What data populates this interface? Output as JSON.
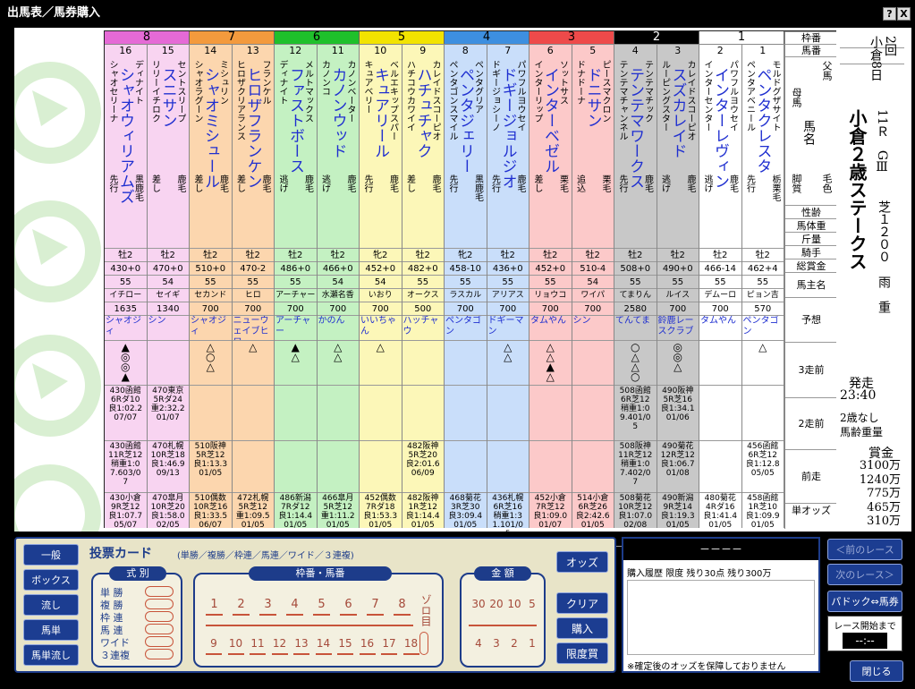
{
  "window": {
    "title": "出馬表／馬券購入",
    "help_label": "?",
    "close_label": "X"
  },
  "race": {
    "kai": "2回",
    "place": "小倉",
    "day": "8日",
    "race_no": "11Ｒ",
    "grade": "GⅢ",
    "name": "小倉２歳ステークス",
    "surface_dist": "芝１２００",
    "weather": "雨",
    "condition": "重",
    "start_label": "発走",
    "start_time": "23:40",
    "cond1": "2歳なし",
    "cond2": "馬齢重量",
    "prize_label": "賞金",
    "prizes": [
      "3100万",
      "1240万",
      "775万",
      "465万",
      "310万"
    ]
  },
  "header_labels": {
    "waku": "枠番",
    "umaban": "馬番",
    "chichi": "父馬",
    "haha": "母馬",
    "bamei": "馬名",
    "kyakushitsu": "脚質",
    "keiro": "毛色",
    "seibetsu": "性齢",
    "bataiju": "馬体重",
    "kinryo": "斤量",
    "kishu": "騎手",
    "shokin": "総賞金",
    "umanushi": "馬主名",
    "yoso": "予想",
    "zen3": "3走前",
    "zen2": "2走前",
    "zen1": "前走",
    "odds": "単オッズ"
  },
  "waku": [
    {
      "n": "8",
      "c": "#e56ad6",
      "bg": "#f8d4f1"
    },
    {
      "n": "7",
      "c": "#f39a3d",
      "bg": "#fcd6ae"
    },
    {
      "n": "6",
      "c": "#1fc02b",
      "bg": "#c4f1c2"
    },
    {
      "n": "5",
      "c": "#f2e300",
      "bg": "#fcf7b8"
    },
    {
      "n": "4",
      "c": "#3d8fe0",
      "bg": "#c9defa"
    },
    {
      "n": "3",
      "c": "#ee4a4a",
      "bg": "#fcc9c9"
    },
    {
      "n": "2",
      "c": "#000000",
      "bg": "#c8c8c8"
    },
    {
      "n": "1",
      "c": "#ffffff",
      "bg": "#ffffff"
    }
  ],
  "horses": [
    {
      "no": "16",
      "waku": 0,
      "father": "ディナイト",
      "mother": "シャオセリーナ",
      "name": "シャオウィリアムズ",
      "style": "先行",
      "color": "黒鹿毛",
      "sexage": "牡2",
      "weight": "430+0",
      "kinryo": "55",
      "jockey": "イチロー",
      "prize": "1635",
      "owner": "シャオジィ",
      "mark": "▲◎◎▲",
      "zen3": "430函館6Rダ10良1:02.207/07",
      "zen2": "430函館11R芝12稍重1:07.603/07",
      "zen1": "430小倉9R芝12良1:07.705/07",
      "odds": "4.1"
    },
    {
      "no": "15",
      "waku": 0,
      "father": "セントスリープ",
      "mother": "リリーイチロク",
      "name": "スニサン",
      "style": "差し",
      "color": "鹿毛",
      "sexage": "牡2",
      "weight": "470+0",
      "kinryo": "54",
      "jockey": "セイギ",
      "prize": "1340",
      "owner": "シン",
      "mark": "",
      "zen3": "470東京5Rダ24重2:32.201/07",
      "zen2": "470札幌10R芝18良1:46.909/13",
      "zen1": "470皐月10R芝20良1:58.002/05",
      "odds": "8.3"
    },
    {
      "no": "14",
      "waku": 1,
      "father": "ミシュリン",
      "mother": "シャオラグーン",
      "name": "シャオミシュール",
      "style": "差し",
      "color": "鹿毛",
      "sexage": "牡2",
      "weight": "510+0",
      "kinryo": "55",
      "jockey": "セカンド",
      "prize": "700",
      "owner": "シャオジィ",
      "mark": "△○△",
      "zen3": "",
      "zen2": "510阪神5R芝12良1:13.301/05",
      "zen1": "510偶数10R芝16良1:33.506/07",
      "odds": "7.3"
    },
    {
      "no": "13",
      "waku": 1,
      "father": "フランケル",
      "mother": "ヒロザクリアランス",
      "name": "ヒロザフランケン",
      "style": "差し",
      "color": "鹿毛",
      "sexage": "牡2",
      "weight": "470-2",
      "kinryo": "55",
      "jockey": "ヒロ",
      "prize": "700",
      "owner": "ニューウェイブヒロ",
      "mark": "△",
      "zen3": "",
      "zen2": "",
      "zen1": "472札幌5R芝12重1:09.501/05",
      "odds": "5.3"
    },
    {
      "no": "12",
      "waku": 2,
      "father": "メルトマックス",
      "mother": "ディナイト",
      "name": "ファストボース",
      "style": "逃げ",
      "color": "鹿毛",
      "sexage": "牡2",
      "weight": "486+0",
      "kinryo": "55",
      "jockey": "アーチャー",
      "prize": "700",
      "owner": "アーチャー",
      "mark": "▲△",
      "zen3": "",
      "zen2": "",
      "zen1": "486新潟7Rダ12良1:14.401/05",
      "odds": "6.1"
    },
    {
      "no": "11",
      "waku": 2,
      "father": "カノンベーター",
      "mother": "カノンコ",
      "name": "カノンウッド",
      "style": "逃げ",
      "color": "鹿毛",
      "sexage": "牡2",
      "weight": "466+0",
      "kinryo": "54",
      "jockey": "水瀬名香",
      "prize": "700",
      "owner": "かのん",
      "mark": "△△",
      "zen3": "",
      "zen2": "",
      "zen1": "466皐月5R芝12重1:11.201/05",
      "odds": "5.1"
    },
    {
      "no": "10",
      "waku": 3,
      "father": "ベルエキップスパー",
      "mother": "キュアベリー",
      "name": "キュアリール",
      "style": "先行",
      "color": "鹿毛",
      "sexage": "牝2",
      "weight": "452+0",
      "kinryo": "54",
      "jockey": "いおり",
      "prize": "700",
      "owner": "いいちゃん",
      "mark": "△",
      "zen3": "",
      "zen2": "",
      "zen1": "452偶数7Rダ18良1:53.301/05",
      "odds": "10.8"
    },
    {
      "no": "9",
      "waku": 3,
      "father": "カレイドスコーピオ",
      "mother": "ハチコウカワイイ",
      "name": "ハチュチャク",
      "style": "差し",
      "color": "鹿毛",
      "sexage": "牡2",
      "weight": "482+0",
      "kinryo": "55",
      "jockey": "オークス",
      "prize": "500",
      "owner": "ハッチャウ",
      "mark": "",
      "zen3": "",
      "zen2": "482阪神5R芝20良2:01.606/09",
      "zen1": "482阪神1R芝12良1:14.401/05",
      "odds": "50.1"
    },
    {
      "no": "8",
      "waku": 4,
      "father": "ペンタグリア",
      "mother": "ペンタゴンスマイル",
      "name": "ペンタジェリー",
      "style": "先行",
      "color": "黒鹿毛",
      "sexage": "牝2",
      "weight": "458-10",
      "kinryo": "55",
      "jockey": "ラスカル",
      "prize": "700",
      "owner": "ペンタゴン",
      "mark": "",
      "zen3": "",
      "zen2": "",
      "zen1": "468菊花3R芝30良3:09.401/05",
      "odds": "116.8"
    },
    {
      "no": "7",
      "waku": 4,
      "father": "パワフルヨウセイ",
      "mother": "ドギージョシーノ",
      "name": "ドギージョルジオ",
      "style": "先行",
      "color": "鹿毛",
      "sexage": "牡2",
      "weight": "436+0",
      "kinryo": "55",
      "jockey": "アリアス",
      "prize": "700",
      "owner": "ドギーマン",
      "mark": "△△",
      "zen3": "",
      "zen2": "",
      "zen1": "436札幌6R芝16稍重1:31.101/05",
      "odds": "24.7"
    },
    {
      "no": "6",
      "waku": 5,
      "father": "ソットサス",
      "mother": "インターリップ",
      "name": "インターベゼル",
      "style": "差し",
      "color": "栗毛",
      "sexage": "牡2",
      "weight": "452+0",
      "kinryo": "55",
      "jockey": "リョウコ",
      "prize": "700",
      "owner": "タムやん",
      "mark": "△△▲△",
      "zen3": "",
      "zen2": "",
      "zen1": "452小倉7R芝12良1:09.001/07",
      "odds": "6.1"
    },
    {
      "no": "5",
      "waku": 5,
      "father": "ピースマクロン",
      "mother": "ドナドーナ",
      "name": "ドニサン",
      "style": "追込",
      "color": "栗毛",
      "sexage": "牡2",
      "weight": "510-4",
      "kinryo": "54",
      "jockey": "ワイパ",
      "prize": "700",
      "owner": "シン",
      "mark": "",
      "zen3": "",
      "zen2": "",
      "zen1": "514小倉6R芝26良2:42.601/05",
      "odds": "16.2"
    },
    {
      "no": "4",
      "waku": 6,
      "father": "テンテマチック",
      "mother": "テンテマチャンネル",
      "name": "テンテマワークス",
      "style": "先行",
      "color": "鹿毛",
      "sexage": "牡2",
      "weight": "508+0",
      "kinryo": "55",
      "jockey": "てまりん",
      "prize": "2580",
      "owner": "てんてま",
      "mark": "○△△○",
      "zen3": "508函館6R芝12稍重1:09.401/05",
      "zen2": "508阪神11R芝12稍重1:07.402/07",
      "zen1": "508菊花10R芝12良1:07.002/08",
      "odds": "3.8"
    },
    {
      "no": "3",
      "waku": 6,
      "father": "カレイドスコーピオ",
      "mother": "ルーピングスター",
      "name": "スズカレイド",
      "style": "逃げ",
      "color": "鹿毛",
      "sexage": "牡2",
      "weight": "490+0",
      "kinryo": "55",
      "jockey": "ルイス",
      "prize": "700",
      "owner": "鈴鹿レースクラブ",
      "mark": "◎◎△",
      "zen3": "490阪神5R芝16良1:34.101/06",
      "zen2": "490菊花12R芝12良1:06.701/08",
      "zen1": "490新潟9R芝14良1:19.301/05",
      "odds": "2.8"
    },
    {
      "no": "2",
      "waku": 7,
      "father": "パワフルヨウセイ",
      "mother": "インターセンター",
      "name": "インターレヴィン",
      "style": "逃げ",
      "color": "鹿毛",
      "sexage": "牡2",
      "weight": "466-14",
      "kinryo": "55",
      "jockey": "デムーロ",
      "prize": "700",
      "owner": "タムやん",
      "mark": "",
      "zen3": "",
      "zen2": "",
      "zen1": "480菊花4Rダ16良1:41.401/05",
      "odds": "44.0"
    },
    {
      "no": "1",
      "waku": 7,
      "father": "モルドグザサイト",
      "mother": "ペンタアベニール",
      "name": "ペンタクレスタ",
      "style": "先行",
      "color": "栃栗毛",
      "sexage": "牡2",
      "weight": "462+4",
      "kinryo": "55",
      "jockey": "ピョン吉",
      "prize": "570",
      "owner": "ペンタゴン",
      "mark": "△",
      "zen3": "",
      "zen2": "456函館6R芝12良1:12.805/05",
      "zen1": "458函館1R芝10良1:09.901/05",
      "odds": "22.0"
    }
  ],
  "vote_card": {
    "title": "投票カード",
    "subtitle": "(単勝／複勝／枠連／馬連／ワイド／３連複)",
    "shiki_title": "式 別",
    "shiki": [
      "単 勝",
      "複 勝",
      "枠 連",
      "馬 連",
      "ワイド",
      "３連複"
    ],
    "uma_title": "枠番・馬番",
    "row1": [
      "1",
      "2",
      "3",
      "4",
      "5",
      "6",
      "7",
      "8"
    ],
    "row2": [
      "9",
      "10",
      "11",
      "12",
      "13",
      "14",
      "15",
      "16",
      "17",
      "18"
    ],
    "zoro": "ゾロ目",
    "kin_title": "金 額",
    "kin1": [
      "30",
      "20",
      "10",
      "5"
    ],
    "kin2": [
      "4",
      "3",
      "2",
      "1"
    ]
  },
  "left_buttons": [
    "一般",
    "ボックス",
    "流し",
    "馬単",
    "馬単流し"
  ],
  "card_buttons": {
    "odds": "オッズ",
    "clear": "クリア",
    "buy": "購入",
    "limit": "限度買"
  },
  "history": {
    "dash": "－－－－",
    "header": "購入履歴 限度  残り30点 残り300万",
    "note": "※確定後のオッズを保障しておりません"
  },
  "right_buttons": {
    "prev": "＜前のレース",
    "next": "次のレース＞",
    "paddock": "パドック⇔馬券",
    "countdown_label": "レース開始まで",
    "countdown": "--:--",
    "close": "閉じる"
  }
}
